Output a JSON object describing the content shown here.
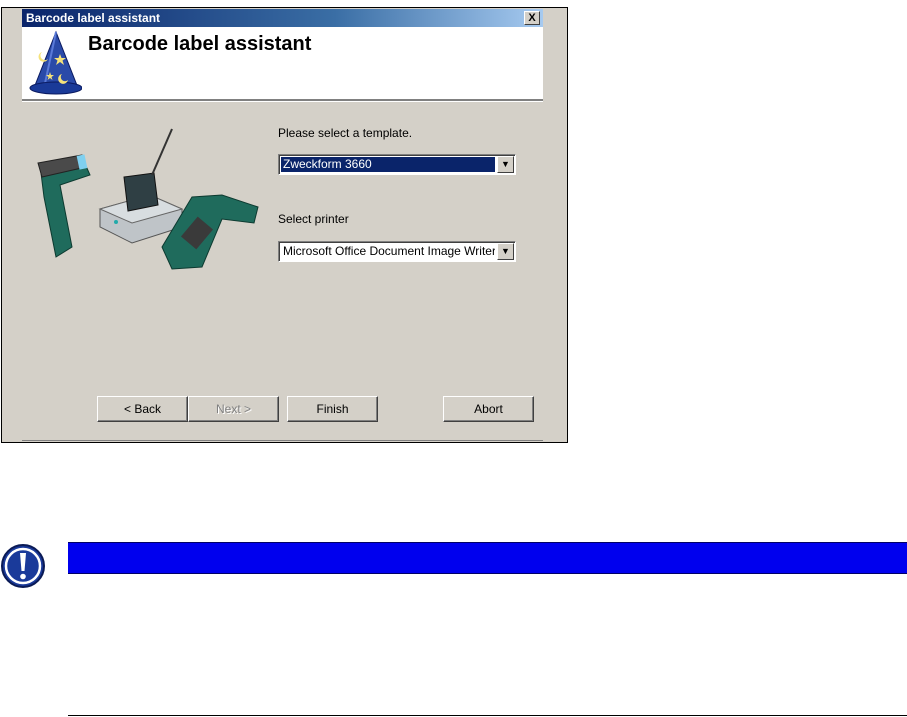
{
  "window": {
    "title": "Barcode label assistant",
    "close_label": "X"
  },
  "header": {
    "title": "Barcode label assistant"
  },
  "form": {
    "template_label": "Please select a template.",
    "template_value": "Zweckform 3660",
    "printer_label": "Select printer",
    "printer_value": "Microsoft Office Document Image Writer",
    "dropdown_arrow": "▼"
  },
  "buttons": {
    "back": "< Back",
    "next": "Next >",
    "finish": "Finish",
    "abort": "Abort"
  },
  "colors": {
    "notice_bar": "#0000ee",
    "title_bar": "#0a246a",
    "dialog_bg": "#d4d0c8"
  },
  "icons": {
    "wizard": "wizard-hat-icon",
    "notice": "exclamation-icon"
  }
}
